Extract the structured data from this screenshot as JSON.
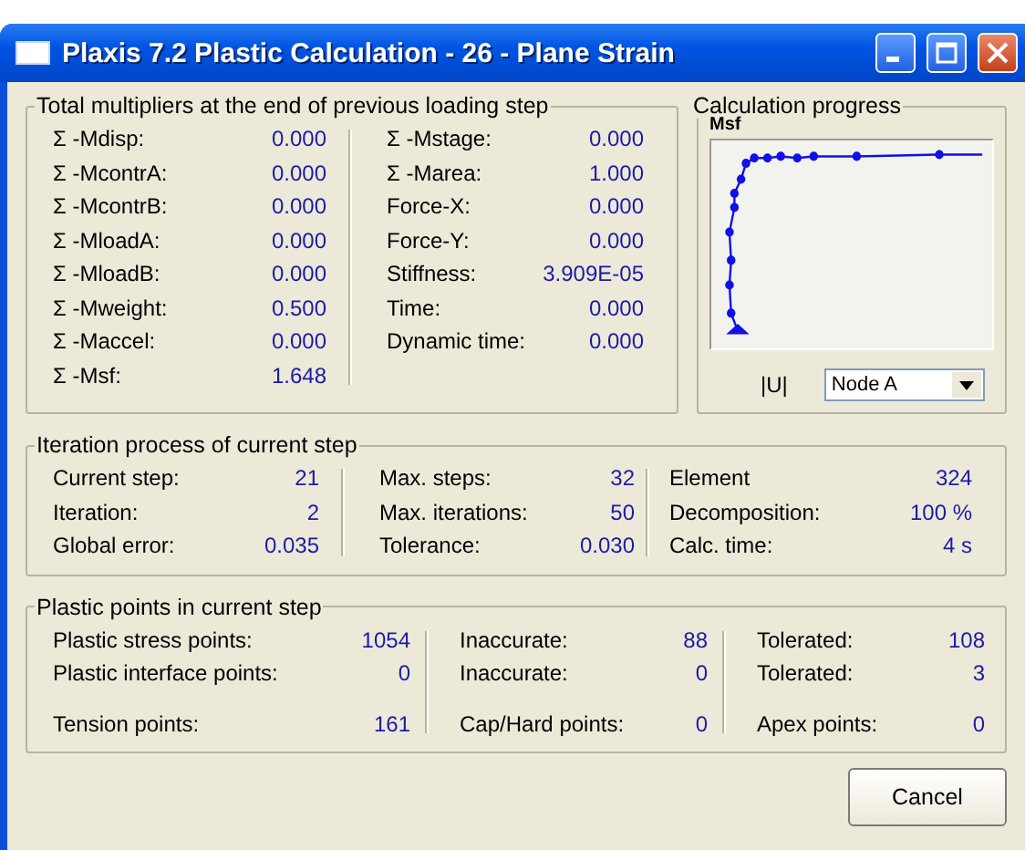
{
  "window": {
    "title": "Plaxis 7.2 Plastic Calculation - 26 - Plane Strain"
  },
  "multipliers": {
    "title": "Total multipliers at the end of previous loading step",
    "columns": [
      [
        {
          "label": "Σ -Mdisp:",
          "value": "0.000"
        },
        {
          "label": "Σ -McontrA:",
          "value": "0.000"
        },
        {
          "label": "Σ -McontrB:",
          "value": "0.000"
        },
        {
          "label": "Σ -MloadA:",
          "value": "0.000"
        },
        {
          "label": "Σ -MloadB:",
          "value": "0.000"
        },
        {
          "label": "Σ -Mweight:",
          "value": "0.500"
        },
        {
          "label": "Σ -Maccel:",
          "value": "0.000"
        },
        {
          "label": "Σ -Msf:",
          "value": "1.648"
        }
      ],
      [
        {
          "label": "Σ -Mstage:",
          "value": "0.000"
        },
        {
          "label": "Σ -Marea:",
          "value": "1.000"
        },
        {
          "label": "Force-X:",
          "value": "0.000"
        },
        {
          "label": "Force-Y:",
          "value": "0.000"
        },
        {
          "label": "Stiffness:",
          "value": "3.909E-05"
        },
        {
          "label": "Time:",
          "value": "0.000"
        },
        {
          "label": "Dynamic time:",
          "value": "0.000"
        }
      ]
    ]
  },
  "progress": {
    "title": "Calculation progress",
    "y_label": "Msf",
    "x_label": "|U|",
    "node_select": {
      "value": "Node A"
    }
  },
  "iteration": {
    "title": "Iteration process of current step",
    "columns": [
      [
        {
          "label": "Current step:",
          "value": "21"
        },
        {
          "label": "Iteration:",
          "value": "2"
        },
        {
          "label": "Global error:",
          "value": "0.035"
        }
      ],
      [
        {
          "label": "Max. steps:",
          "value": "32"
        },
        {
          "label": "Max. iterations:",
          "value": "50"
        },
        {
          "label": "Tolerance:",
          "value": "0.030"
        }
      ],
      [
        {
          "label": "Element",
          "value": "324"
        },
        {
          "label": "Decomposition:",
          "value": "100 %"
        },
        {
          "label": "Calc. time:",
          "value": "4 s"
        }
      ]
    ]
  },
  "plastic": {
    "title": "Plastic points in current step",
    "columns": [
      [
        {
          "label": "Plastic stress points:",
          "value": "1054"
        },
        {
          "label": "Plastic interface points:",
          "value": "0"
        },
        {
          "label": "Tension points:",
          "value": "161"
        }
      ],
      [
        {
          "label": "Inaccurate:",
          "value": "88"
        },
        {
          "label": "Inaccurate:",
          "value": "0"
        },
        {
          "label": "Cap/Hard points:",
          "value": "0"
        }
      ],
      [
        {
          "label": "Tolerated:",
          "value": "108"
        },
        {
          "label": "Tolerated:",
          "value": "3"
        },
        {
          "label": "Apex points:",
          "value": "0"
        }
      ]
    ]
  },
  "buttons": [
    {
      "label": "Cancel"
    }
  ]
}
